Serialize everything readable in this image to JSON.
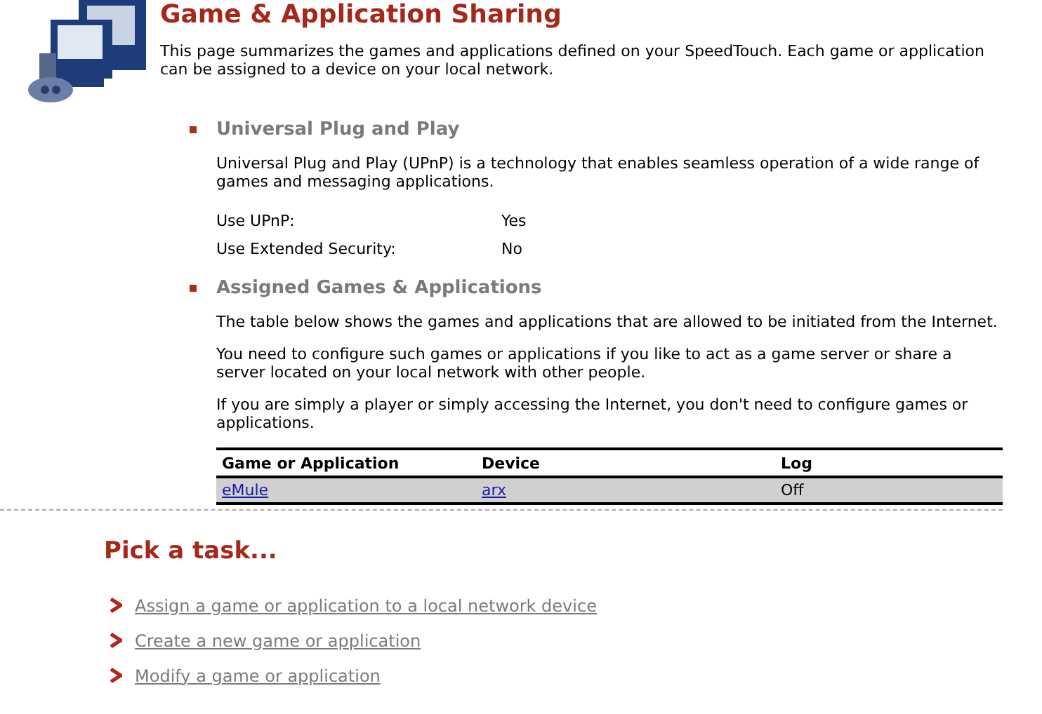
{
  "title": "Game & Application Sharing",
  "intro": "This page summarizes the games and applications defined on your SpeedTouch. Each game or application can be assigned to a device on your local network.",
  "sections": [
    {
      "heading": "Universal Plug and Play",
      "paragraphs": [
        "Universal Plug and Play (UPnP) is a technology that enables seamless operation of a wide range of games and messaging applications."
      ],
      "settings": [
        {
          "label": "Use UPnP:",
          "value": "Yes"
        },
        {
          "label": "Use Extended Security:",
          "value": "No"
        }
      ]
    },
    {
      "heading": "Assigned Games & Applications",
      "paragraphs": [
        "The table below shows the games and applications that are allowed to be initiated from the Internet.",
        "You need to configure such games or applications if you like to act as a game server or share a server located on your local network with other people.",
        "If you are simply a player or simply accessing the Internet, you don't need to configure games or applications."
      ],
      "table": {
        "columns": [
          "Game or Application",
          "Device",
          "Log"
        ],
        "rows": [
          {
            "game": "eMule",
            "device": "arx",
            "log": "Off"
          }
        ]
      }
    }
  ],
  "tasks_heading": "Pick a task...",
  "tasks": [
    "Assign a game or application to a local network device",
    "Create a new game or application",
    "Modify a game or application"
  ]
}
